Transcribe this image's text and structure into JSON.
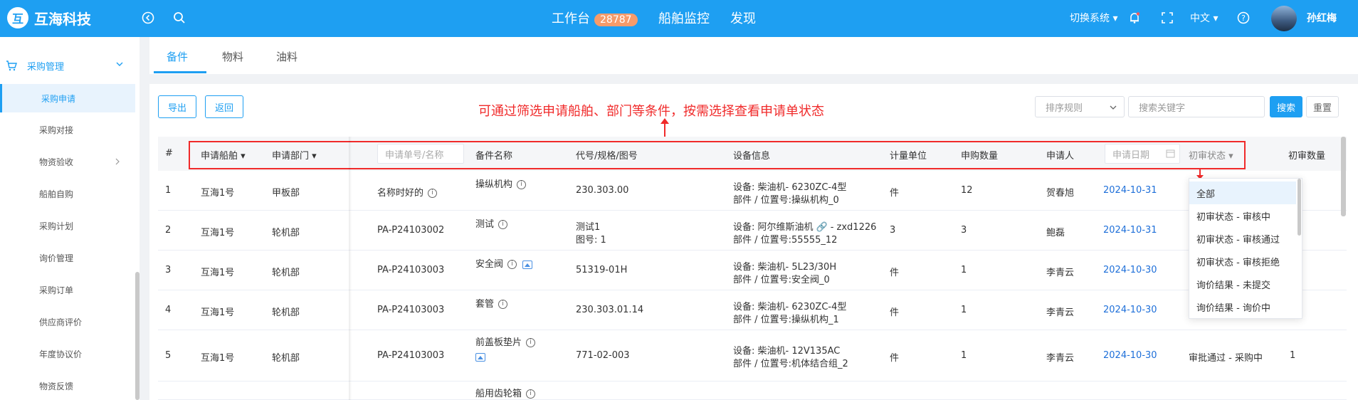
{
  "header": {
    "logo_mark": "互",
    "logo_text": "互海科技",
    "nav": [
      {
        "label": "工作台",
        "badge": "28787"
      },
      {
        "label": "船舶监控"
      },
      {
        "label": "发现"
      }
    ],
    "switch_system": "切换系统 ▾",
    "language": "中文 ▾",
    "username": "孙红梅"
  },
  "sidebar": {
    "group": "采购管理",
    "items": [
      "采购申请",
      "采购对接",
      "物资验收",
      "船舶自购",
      "采购计划",
      "询价管理",
      "采购订单",
      "供应商评价",
      "年度协议价",
      "物资反馈"
    ]
  },
  "tabs": [
    "备件",
    "物料",
    "油料"
  ],
  "toolbar": {
    "export_label": "导出",
    "back_label": "返回",
    "sort_placeholder": "排序规则",
    "search_placeholder": "搜索关键字",
    "search_button": "搜索",
    "reset_button": "重置"
  },
  "annotation": "可通过筛选申请船舶、部门等条件，按需选择查看申请单状态",
  "table": {
    "headers": {
      "index": "#",
      "ship": "申请船舶",
      "dept": "申请部门",
      "req_no_placeholder": "申请单号/名称",
      "part_name": "备件名称",
      "code": "代号/规格/图号",
      "equipment": "设备信息",
      "unit": "计量单位",
      "qty": "申购数量",
      "applicant": "申请人",
      "date_placeholder": "申请日期",
      "status": "初审状态",
      "review_qty": "初审数量"
    },
    "rows": [
      {
        "idx": "1",
        "ship": "互海1号",
        "dept": "甲板部",
        "req": "名称时好的",
        "part": "操纵机构",
        "code1": "230.303.00",
        "code2": "",
        "eq1": "设备: 柴油机- 6230ZC-4型",
        "eq2": "部件 / 位置号:操纵机构_0",
        "unit": "件",
        "qty": "12",
        "applicant": "贺春旭",
        "date": "2024-10-31",
        "status": "",
        "review": ""
      },
      {
        "idx": "2",
        "ship": "互海1号",
        "dept": "轮机部",
        "req": "PA-P24103002",
        "part": "测试",
        "code1": "测试1",
        "code2": "图号:  1",
        "eq1": "设备: 阿尔维斯油机",
        "eq1b": "- zxd1226",
        "eq2": "部件 / 位置号:55555_12",
        "unit": "3",
        "qty": "3",
        "applicant": "鲍磊",
        "date": "2024-10-31",
        "status": "",
        "review": ""
      },
      {
        "idx": "3",
        "ship": "互海1号",
        "dept": "轮机部",
        "req": "PA-P24103003",
        "part": "安全阀",
        "code1": "51319-01H",
        "code2": "",
        "eq1": "设备: 柴油机- 5L23/30H",
        "eq2": "部件 / 位置号:安全阀_0",
        "unit": "件",
        "qty": "1",
        "applicant": "李青云",
        "date": "2024-10-30",
        "status": "",
        "review": ""
      },
      {
        "idx": "4",
        "ship": "互海1号",
        "dept": "轮机部",
        "req": "PA-P24103003",
        "part": "套管",
        "code1": "230.303.01.14",
        "code2": "",
        "eq1": "设备: 柴油机- 6230ZC-4型",
        "eq2": "部件 / 位置号:操纵机构_1",
        "unit": "件",
        "qty": "1",
        "applicant": "李青云",
        "date": "2024-10-30",
        "status": "",
        "review": ""
      },
      {
        "idx": "5",
        "ship": "互海1号",
        "dept": "轮机部",
        "req": "PA-P24103003",
        "part": "前盖板垫片",
        "code1": "771-02-003",
        "code2": "",
        "eq1": "设备: 柴油机- 12V135AC",
        "eq2": "部件 / 位置号:机体结合组_2",
        "unit": "件",
        "qty": "1",
        "applicant": "李青云",
        "date": "2024-10-30",
        "status": "审批通过 - 采购中",
        "review": "1"
      },
      {
        "idx": "",
        "ship": "",
        "dept": "",
        "req": "",
        "part": "船用齿轮箱",
        "code1": "",
        "code2": "",
        "eq1": "",
        "eq2": "",
        "unit": "",
        "qty": "",
        "applicant": "",
        "date": "",
        "status": "",
        "review": ""
      }
    ]
  },
  "status_dropdown": [
    "全部",
    "初审状态 - 审核中",
    "初审状态 - 审核通过",
    "初审状态 - 审核拒绝",
    "询价结果 - 未提交",
    "询价结果 - 询价中"
  ]
}
